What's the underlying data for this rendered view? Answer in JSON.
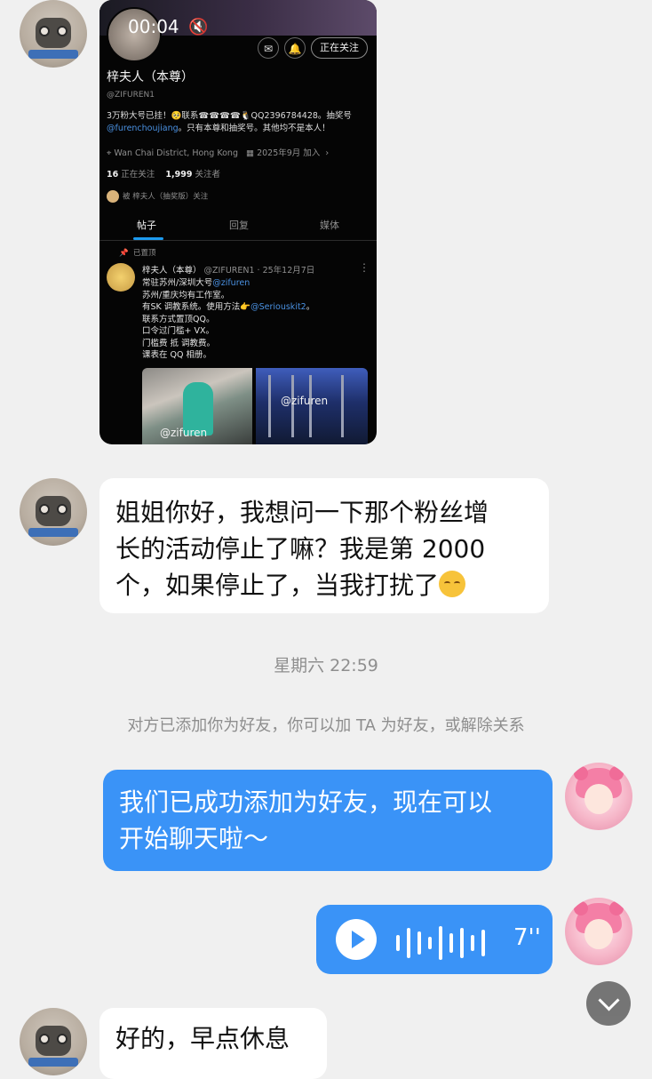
{
  "shared_post": {
    "video_time": "00:04",
    "follow_button": "正在关注",
    "name": "梓夫人（本尊）",
    "handle": "@ZIFUREN1",
    "bio_line1": "3万粉大号已挂！🥺联系☎☎☎☎🐧QQ2396784428。抽奖号",
    "bio_link": "@furenchoujiang",
    "bio_line2": "。只有本尊和抽奖号。其他均不是本人！",
    "location": "Wan Chai District, Hong Kong",
    "joined": "2025年9月 加入",
    "following_count": "16",
    "following_label": "正在关注",
    "followers_count": "1,999",
    "followers_label": "关注者",
    "followed_by": "被 梓夫人（抽奖版）关注",
    "tabs": [
      "帖子",
      "回复",
      "媒体"
    ],
    "pinned_label": "已置顶",
    "post_author": "梓夫人（本尊）",
    "post_meta": "@ZIFUREN1 · 25年12月7日",
    "post_line1": "常驻苏州/深圳大号",
    "post_line1_link": "@zifuren",
    "post_line2": "苏州/重庆均有工作室。",
    "post_line3": "有SK 调教系统。使用方法👉",
    "post_line3_link": "@Seriouskit2",
    "post_line3_end": "。",
    "post_line4": "联系方式置顶QQ。",
    "post_line5": "口令过门槛+  VX。",
    "post_line6": "门槛费 抵 调教费。",
    "post_line7": "课表在  QQ 相册。",
    "watermark": "@zifuren"
  },
  "messages": {
    "msg1_line1": "姐姐你好，我想问一下那个粉丝增",
    "msg1_line2": "长的活动停止了嘛？我是第 2000",
    "msg1_line3": "个，如果停止了，当我打扰了",
    "timestamp": "星期六 22:59",
    "system": "对方已添加你为好友，你可以加 TA 为好友，或解除关系",
    "msg2_line1": "我们已成功添加为好友，现在可以",
    "msg2_line2": "开始聊天啦～",
    "voice_duration": "7''",
    "msg3": "好的，早点休息"
  }
}
